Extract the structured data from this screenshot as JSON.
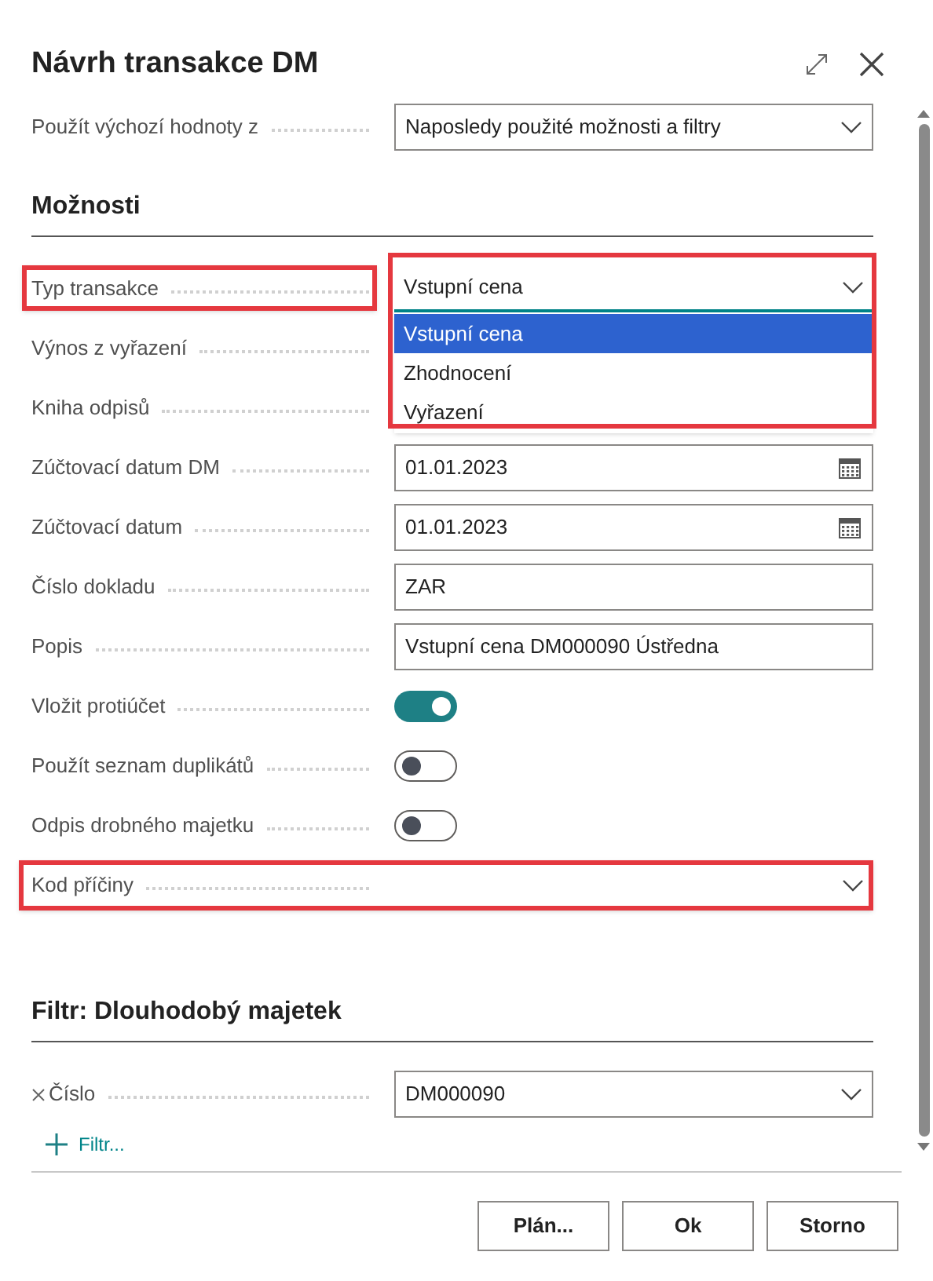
{
  "dialog": {
    "title": "Návrh transakce DM"
  },
  "defaults": {
    "label": "Použít výchozí hodnoty z",
    "value": "Naposledy použité možnosti a filtry"
  },
  "options_section": {
    "heading": "Možnosti",
    "rows": [
      {
        "label": "Typ transakce",
        "kind": "select",
        "value": "Vstupní cena",
        "highlighted": true,
        "expanded": true,
        "options": [
          {
            "label": "Vstupní cena",
            "selected": true
          },
          {
            "label": "Zhodnocení",
            "selected": false
          },
          {
            "label": "Vyřazení",
            "selected": false
          }
        ]
      },
      {
        "label": "Výnos z vyřazení",
        "kind": "covered",
        "highlighted": false
      },
      {
        "label": "Kniha odpisů",
        "kind": "covered",
        "highlighted": false
      },
      {
        "label": "Zúčtovací datum DM",
        "kind": "date",
        "value": "01.01.2023",
        "highlighted": false
      },
      {
        "label": "Zúčtovací datum",
        "kind": "date",
        "value": "01.01.2023",
        "highlighted": false
      },
      {
        "label": "Číslo dokladu",
        "kind": "text",
        "value": "ZAR",
        "highlighted": false
      },
      {
        "label": "Popis",
        "kind": "text",
        "value": "Vstupní cena DM000090 Ústředna",
        "highlighted": false
      },
      {
        "label": "Vložit protiúčet",
        "kind": "toggle",
        "on": true,
        "highlighted": false
      },
      {
        "label": "Použít seznam duplikátů",
        "kind": "toggle",
        "on": false,
        "highlighted": false
      },
      {
        "label": "Odpis drobného majetku",
        "kind": "toggle",
        "on": false,
        "highlighted": false
      },
      {
        "label": "Kod příčiny",
        "kind": "select",
        "value": "",
        "highlighted": true,
        "expanded": false
      }
    ]
  },
  "filter_section": {
    "heading": "Filtr: Dlouhodobý majetek",
    "filters": [
      {
        "label": "Číslo",
        "value": "DM000090"
      }
    ],
    "add_filter": "Filtr..."
  },
  "buttons": [
    "Plán...",
    "Ok",
    "Storno"
  ]
}
